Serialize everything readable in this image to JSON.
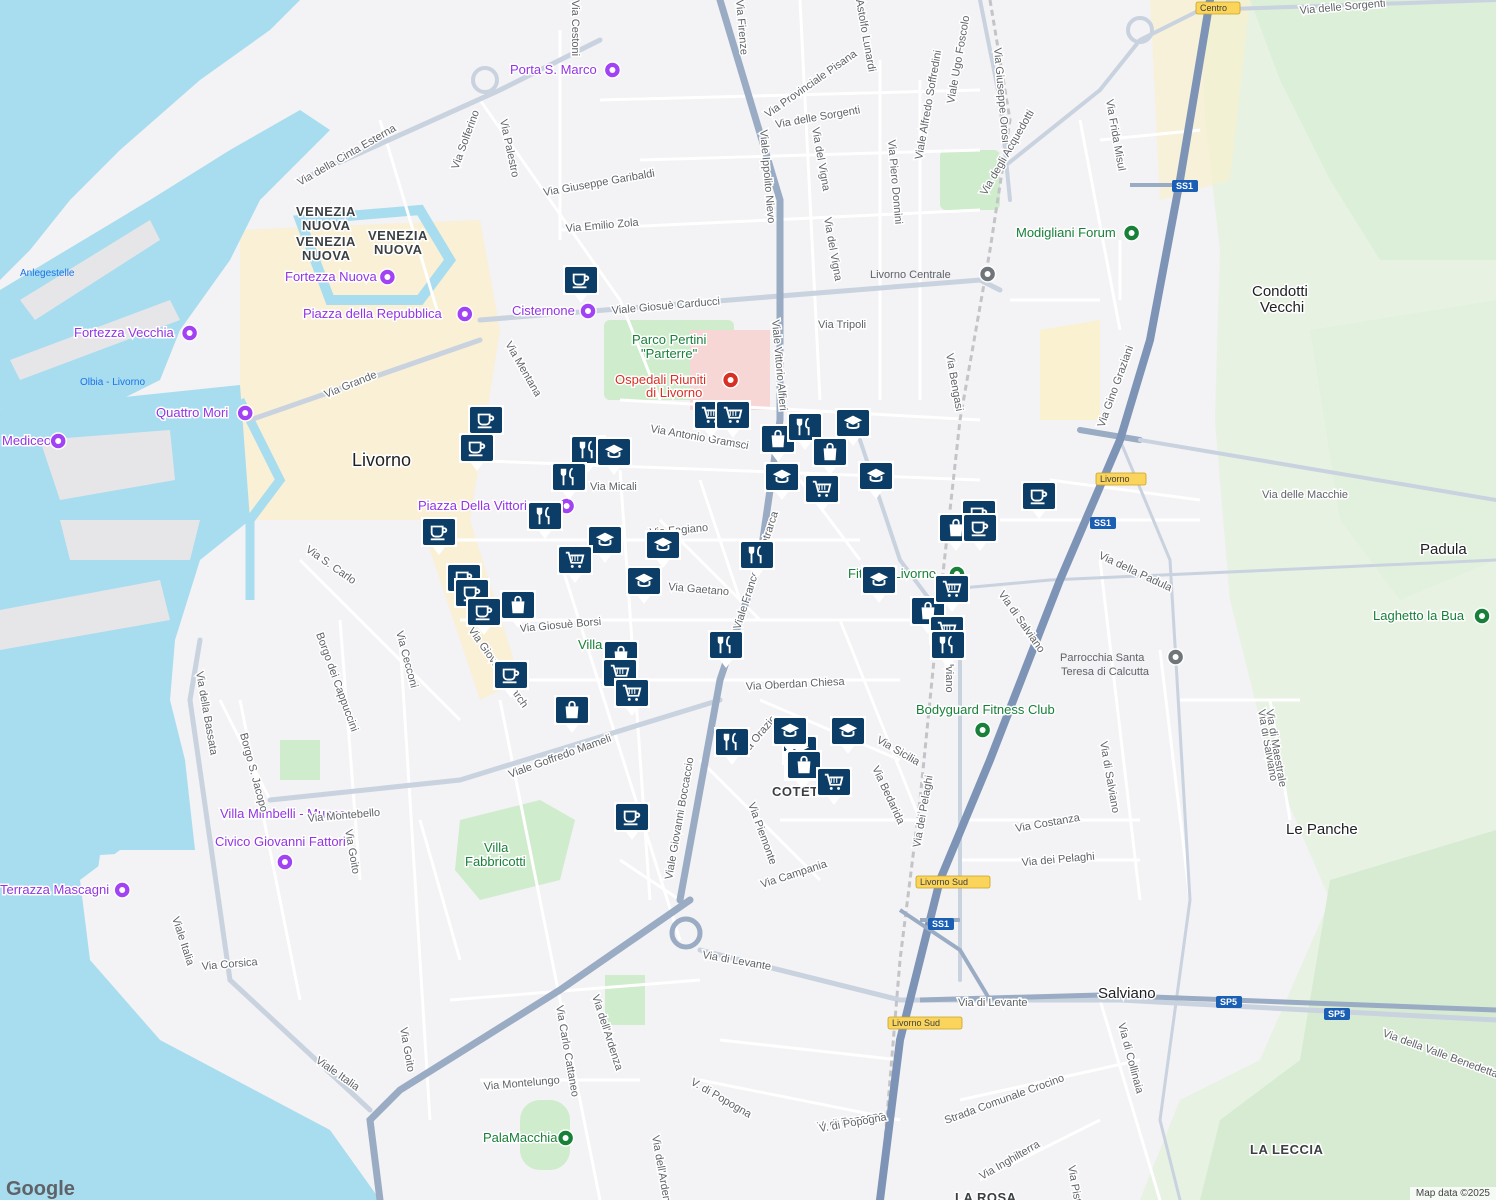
{
  "map": {
    "attribution": "Map data ©2025",
    "logo": "Google",
    "colors": {
      "water": "#a8dcef",
      "land": "#f3f2f4",
      "park": "#cfeccd",
      "highway": "#8ea4c2",
      "marker": "#0b3d66",
      "urban": "#fbf0c8"
    }
  },
  "labels": {
    "districts": [
      {
        "id": "venezia-nuova-1",
        "text": "VENEZIA"
      },
      {
        "id": "venezia-nuova-1b",
        "text": "NUOVA"
      },
      {
        "id": "venezia-nuova-2",
        "text": "VENEZIA"
      },
      {
        "id": "venezia-nuova-2b",
        "text": "NUOVA"
      },
      {
        "id": "venezia-nuova-3",
        "text": "VENEZIA"
      },
      {
        "id": "venezia-nuova-3b",
        "text": "NUOVA"
      },
      {
        "id": "coteto",
        "text": "COTETO"
      },
      {
        "id": "la-leccia",
        "text": "LA LECCIA"
      },
      {
        "id": "la-rosa",
        "text": "LA ROSA"
      }
    ],
    "cities": [
      {
        "id": "livorno",
        "text": "Livorno"
      },
      {
        "id": "padula",
        "text": "Padula"
      },
      {
        "id": "condotti-1",
        "text": "Condotti"
      },
      {
        "id": "condotti-2",
        "text": "Vecchi"
      },
      {
        "id": "le-panche",
        "text": "Le Panche"
      },
      {
        "id": "salviano",
        "text": "Salviano"
      }
    ],
    "pois": [
      {
        "id": "porta-s-marco",
        "text": "Porta S. Marco",
        "kind": "purple"
      },
      {
        "id": "fortezza-nuova",
        "text": "Fortezza Nuova",
        "kind": "purple"
      },
      {
        "id": "piazza-repubblica",
        "text": "Piazza della Repubblica",
        "kind": "purple"
      },
      {
        "id": "cisternone",
        "text": "Cisternone",
        "kind": "purple"
      },
      {
        "id": "fortezza-vecchia",
        "text": "Fortezza Vecchia",
        "kind": "purple"
      },
      {
        "id": "quattro-mori",
        "text": "Quattro Mori",
        "kind": "purple"
      },
      {
        "id": "mediceo",
        "text": "Mediceo",
        "kind": "purple"
      },
      {
        "id": "piazza-vittoria",
        "text": "Piazza Della Vittoria",
        "kind": "purple"
      },
      {
        "id": "villa-mimbelli-1",
        "text": "Villa Mimbelli - Museo",
        "kind": "purple"
      },
      {
        "id": "villa-mimbelli-2",
        "text": "Civico Giovanni Fattori",
        "kind": "purple"
      },
      {
        "id": "terrazza-mascagni",
        "text": "Terrazza Mascagni",
        "kind": "purple"
      },
      {
        "id": "modigliani-forum",
        "text": "Modigliani Forum",
        "kind": "green"
      },
      {
        "id": "parco-pertini-1",
        "text": "Parco Pertini",
        "kind": "green"
      },
      {
        "id": "parco-pertini-2",
        "text": "\"Parterre\"",
        "kind": "green"
      },
      {
        "id": "ospedali-1",
        "text": "Ospedali Riuniti",
        "kind": "red"
      },
      {
        "id": "ospedali-2",
        "text": "di Livorno",
        "kind": "red"
      },
      {
        "id": "fitness-livorno",
        "text": "Fitness Livorno",
        "kind": "green"
      },
      {
        "id": "bodyguard",
        "text": "Bodyguard Fitness Club",
        "kind": "green"
      },
      {
        "id": "laghetto",
        "text": "Laghetto la Bua",
        "kind": "green"
      },
      {
        "id": "parrocchia-1",
        "text": "Parrocchia Santa",
        "kind": "gray"
      },
      {
        "id": "parrocchia-2",
        "text": "Teresa di Calcutta",
        "kind": "gray"
      },
      {
        "id": "villa-fabbricotti-1",
        "text": "Villa",
        "kind": "green"
      },
      {
        "id": "villa-fabbricotti-2",
        "text": "Fabbricotti",
        "kind": "green"
      },
      {
        "id": "villa-small",
        "text": "Villa",
        "kind": "green"
      },
      {
        "id": "palamacchia",
        "text": "PalaMacchia",
        "kind": "green"
      },
      {
        "id": "livorno-centrale",
        "text": "Livorno Centrale",
        "kind": "gray"
      },
      {
        "id": "anlegestelle",
        "text": "Anlegestelle",
        "kind": "water"
      },
      {
        "id": "olbia",
        "text": "Olbia - Livorno",
        "kind": "water"
      }
    ],
    "streets": [
      {
        "id": "s1",
        "text": "Via della Cinta Esterna"
      },
      {
        "id": "s2",
        "text": "Via Palestro"
      },
      {
        "id": "s3",
        "text": "Via Solferino"
      },
      {
        "id": "s4",
        "text": "Via Giuseppe Garibaldi"
      },
      {
        "id": "s5",
        "text": "Via Emilio Zola"
      },
      {
        "id": "s6",
        "text": "Viale Giosuè Carducci"
      },
      {
        "id": "s7",
        "text": "Via Tripoli"
      },
      {
        "id": "s8",
        "text": "Via Mentana"
      },
      {
        "id": "s9",
        "text": "Via Grande"
      },
      {
        "id": "s10",
        "text": "Via Antonio Gramsci"
      },
      {
        "id": "s11",
        "text": "Via Micali"
      },
      {
        "id": "s12",
        "text": "Via Fagiano"
      },
      {
        "id": "s13",
        "text": "Via S. Carlo"
      },
      {
        "id": "s14",
        "text": "Via Gaetano"
      },
      {
        "id": "s15",
        "text": "Via Giosuè Borsi"
      },
      {
        "id": "s16",
        "text": "Via Giovanni March"
      },
      {
        "id": "s17",
        "text": "Borgo dei Cappuccini"
      },
      {
        "id": "s18",
        "text": "Via Cecconi"
      },
      {
        "id": "s19",
        "text": "Via della Bassata"
      },
      {
        "id": "s20",
        "text": "Borgo S. Jacopo"
      },
      {
        "id": "s21",
        "text": "Viale Goffredo Mameli"
      },
      {
        "id": "s22",
        "text": "Via Montebello"
      },
      {
        "id": "s23",
        "text": "Via Goito"
      },
      {
        "id": "s24",
        "text": "Viale Italia"
      },
      {
        "id": "s25",
        "text": "Via Corsica"
      },
      {
        "id": "s26",
        "text": "Viale Italia"
      },
      {
        "id": "s27",
        "text": "Via Goito"
      },
      {
        "id": "s28",
        "text": "Via Montelungo"
      },
      {
        "id": "s29",
        "text": "Via Carlo Cattaneo"
      },
      {
        "id": "s30",
        "text": "Via dell'Ardenza"
      },
      {
        "id": "s31",
        "text": "V. di Popogna"
      },
      {
        "id": "s32",
        "text": "V. di Popogna"
      },
      {
        "id": "s33",
        "text": "Via di Levante"
      },
      {
        "id": "s34",
        "text": "Via di Levante"
      },
      {
        "id": "s35",
        "text": "Viale Giovanni Boccaccio"
      },
      {
        "id": "s36",
        "text": "Via Campania"
      },
      {
        "id": "s37",
        "text": "Via Piemonte"
      },
      {
        "id": "s38",
        "text": "Via Oberdan Chiesa"
      },
      {
        "id": "s39",
        "text": "Via Sicilia"
      },
      {
        "id": "s40",
        "text": "Via Bedarida"
      },
      {
        "id": "s41",
        "text": "Via dei Pelaghi"
      },
      {
        "id": "s42",
        "text": "Via Costanza"
      },
      {
        "id": "s43",
        "text": "Via dei Pelaghi"
      },
      {
        "id": "s44",
        "text": "Via di Salviano"
      },
      {
        "id": "s45",
        "text": "Via di Salviano"
      },
      {
        "id": "s46",
        "text": "Via della Padula"
      },
      {
        "id": "s47",
        "text": "Via delle Macchie"
      },
      {
        "id": "s48",
        "text": "Via Gino Graziani"
      },
      {
        "id": "s49",
        "text": "Via di Collinaia"
      },
      {
        "id": "s50",
        "text": "Via della Valle Benedetta"
      },
      {
        "id": "s51",
        "text": "Strada Comunale Crocino"
      },
      {
        "id": "s52",
        "text": "Via Inghilterra"
      },
      {
        "id": "s53",
        "text": "V. di Popogna"
      },
      {
        "id": "s54",
        "text": "Via Firenze"
      },
      {
        "id": "s55",
        "text": "Viale Ippolito Nievo"
      },
      {
        "id": "s56",
        "text": "Viale Vittorio Alfieri"
      },
      {
        "id": "s57",
        "text": "Viale Francesco Petrarca"
      },
      {
        "id": "s58",
        "text": "Via Provinciale Pisana"
      },
      {
        "id": "s59",
        "text": "Via delle Sorgenti"
      },
      {
        "id": "s60",
        "text": "Via del Vigna"
      },
      {
        "id": "s61",
        "text": "Via del Vigna"
      },
      {
        "id": "s62",
        "text": "Astolfo Lunardi"
      },
      {
        "id": "s63",
        "text": "Via Piero Donnini"
      },
      {
        "id": "s64",
        "text": "Viale Alfredo Soffredini"
      },
      {
        "id": "s65",
        "text": "Viale Ugo Foscolo"
      },
      {
        "id": "s66",
        "text": "Via Giuseppe Orosi"
      },
      {
        "id": "s67",
        "text": "Via degli Acquedotti"
      },
      {
        "id": "s68",
        "text": "Via Frida Misul"
      },
      {
        "id": "s69",
        "text": "Via delle Sorgenti"
      },
      {
        "id": "s70",
        "text": "Via Bengasi"
      },
      {
        "id": "s71",
        "text": "Via di Salviano"
      },
      {
        "id": "s72",
        "text": "Via Cestoni"
      },
      {
        "id": "s73",
        "text": "Via di Salviano"
      },
      {
        "id": "s74",
        "text": "Via di Maestrale"
      },
      {
        "id": "s75",
        "text": "Via dell'Ardenza"
      },
      {
        "id": "s76",
        "text": "Via Pistoia"
      },
      {
        "id": "s77",
        "text": "Via Orazio"
      }
    ],
    "shields": [
      {
        "id": "ss1-a",
        "text": "SS1"
      },
      {
        "id": "ss1-b",
        "text": "SS1"
      },
      {
        "id": "ss1-c",
        "text": "SS1"
      },
      {
        "id": "sp5-a",
        "text": "SP5"
      },
      {
        "id": "sp5-b",
        "text": "SP5"
      },
      {
        "id": "exit-centro",
        "text": "Centro"
      },
      {
        "id": "exit-livorno",
        "text": "Livorno"
      },
      {
        "id": "exit-livsud-1",
        "text": "Livorno Sud"
      },
      {
        "id": "exit-livsud-2",
        "text": "Livorno Sud"
      }
    ]
  },
  "markers": [
    {
      "icon": "coffee"
    },
    {
      "icon": "coffee"
    },
    {
      "icon": "coffee"
    },
    {
      "icon": "restaurant"
    },
    {
      "icon": "school"
    },
    {
      "icon": "restaurant"
    },
    {
      "icon": "restaurant"
    },
    {
      "icon": "coffee"
    },
    {
      "icon": "school"
    },
    {
      "icon": "cart"
    },
    {
      "icon": "school"
    },
    {
      "icon": "school"
    },
    {
      "icon": "coffee"
    },
    {
      "icon": "coffee"
    },
    {
      "icon": "coffee"
    },
    {
      "icon": "bag"
    },
    {
      "icon": "bag"
    },
    {
      "icon": "cart"
    },
    {
      "icon": "cart"
    },
    {
      "icon": "coffee"
    },
    {
      "icon": "bag"
    },
    {
      "icon": "restaurant"
    },
    {
      "icon": "coffee"
    },
    {
      "icon": "cart"
    },
    {
      "icon": "cart"
    },
    {
      "icon": "bag"
    },
    {
      "icon": "restaurant"
    },
    {
      "icon": "school"
    },
    {
      "icon": "bag"
    },
    {
      "icon": "school"
    },
    {
      "icon": "school"
    },
    {
      "icon": "cart"
    },
    {
      "icon": "school"
    },
    {
      "icon": "restaurant"
    },
    {
      "icon": "coffee"
    },
    {
      "icon": "bag"
    },
    {
      "icon": "coffee"
    },
    {
      "icon": "school"
    },
    {
      "icon": "bag"
    },
    {
      "icon": "bag"
    },
    {
      "icon": "cart"
    },
    {
      "icon": "cart"
    },
    {
      "icon": "restaurant"
    },
    {
      "icon": "school"
    },
    {
      "icon": "school"
    },
    {
      "icon": "bag"
    },
    {
      "icon": "cart"
    },
    {
      "icon": "restaurant"
    },
    {
      "icon": "coffee"
    }
  ]
}
